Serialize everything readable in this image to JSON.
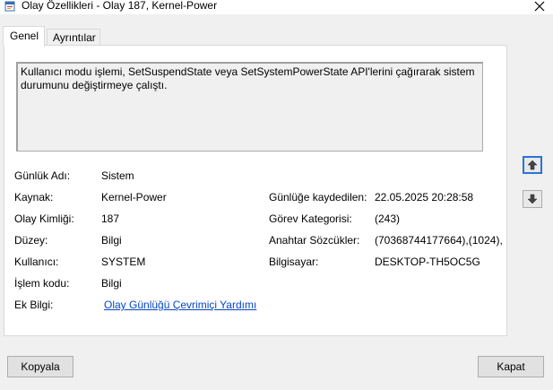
{
  "window": {
    "title": "Olay Özellikleri - Olay 187, Kernel-Power",
    "icon": "event-viewer-icon",
    "close_icon": "close-icon"
  },
  "tabs": [
    {
      "label": "Genel",
      "active": true
    },
    {
      "label": "Ayrıntılar",
      "active": false
    }
  ],
  "description": "Kullanıcı modu işlemi, SetSuspendState veya SetSystemPowerState API'lerini çağırarak sistem durumunu değiştirmeye çalıştı.",
  "fields_left": [
    {
      "label": "Günlük Adı:",
      "value": "Sistem"
    },
    {
      "label": "Kaynak:",
      "value": "Kernel-Power"
    },
    {
      "label": "Olay Kimliği:",
      "value": "187"
    },
    {
      "label": "Düzey:",
      "value": "Bilgi"
    },
    {
      "label": "Kullanıcı:",
      "value": "SYSTEM"
    },
    {
      "label": "İşlem kodu:",
      "value": "Bilgi"
    },
    {
      "label": "Ek Bilgi:",
      "value": "Olay Günlüğü Çevrimiçi Yardımı"
    }
  ],
  "fields_right": [
    {
      "label": "Günlüğe kaydedilen:",
      "value": "22.05.2025 20:28:58"
    },
    {
      "label": "Görev Kategorisi:",
      "value": "(243)"
    },
    {
      "label": "Anahtar Sözcükler:",
      "value": "(70368744177664),(1024),"
    },
    {
      "label": "Bilgisayar:",
      "value": "DESKTOP-TH5OC5G"
    }
  ],
  "buttons": {
    "copy": "Kopyala",
    "close": "Kapat",
    "up_icon": "arrow-up-icon",
    "down_icon": "arrow-down-icon"
  },
  "colors": {
    "link": "#0645c8",
    "accent": "#2b74d6"
  }
}
